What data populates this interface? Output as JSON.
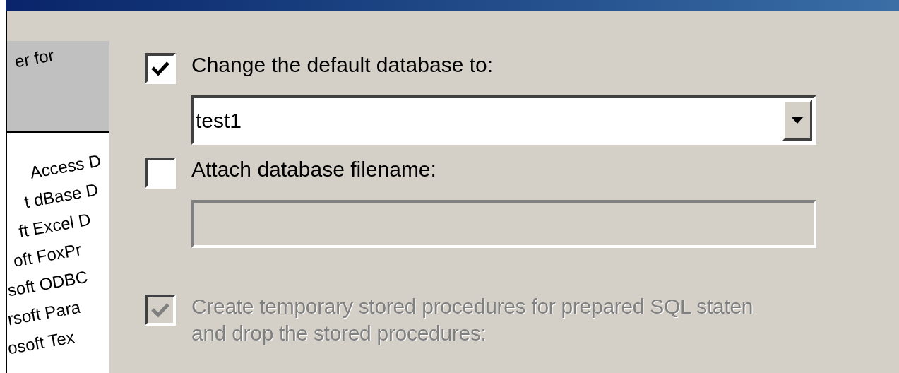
{
  "illustration": {
    "lines": [
      "er for",
      "Access D",
      "t dBase D",
      "ft Excel D",
      "oft FoxPr",
      "soft ODBC",
      "rsoft Para",
      "osoft Tex"
    ]
  },
  "options": [
    {
      "kind": "checkbox",
      "label": "Change the default database to:",
      "checked": true,
      "disabled": false
    },
    {
      "kind": "combo",
      "value": "test1"
    },
    {
      "kind": "checkbox",
      "label": "Attach database filename:",
      "checked": false,
      "disabled": false
    },
    {
      "kind": "field",
      "disabled": true
    },
    {
      "kind": "checkbox",
      "label": "Create temporary stored procedures for prepared SQL staten",
      "label_2": "and drop the stored procedures:",
      "checked": true,
      "disabled": true
    }
  ]
}
